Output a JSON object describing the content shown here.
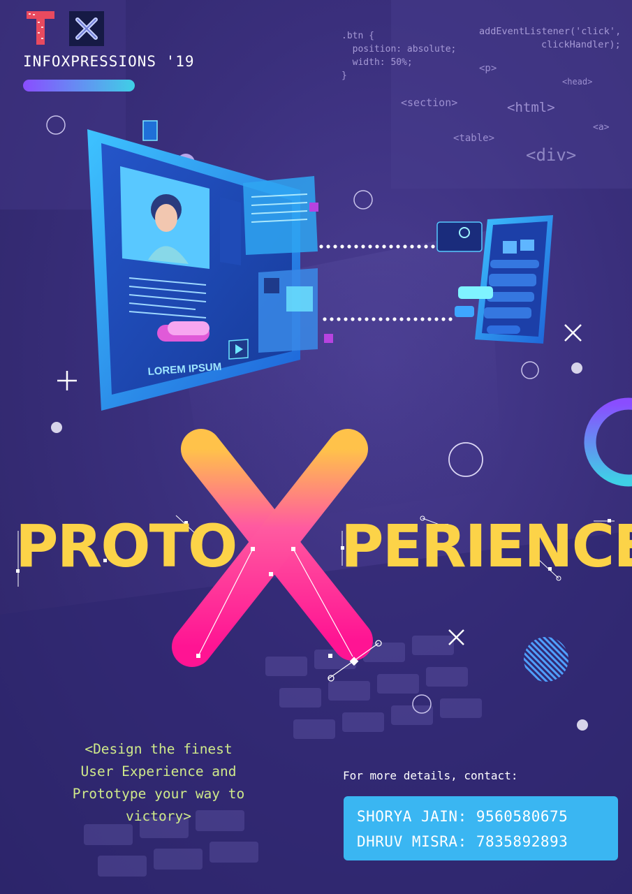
{
  "brand": {
    "logo_t_icon": "T-logo-icon",
    "logo_x_icon": "X-logo-icon",
    "event_name": "INFOXPRESSIONS '19"
  },
  "code_snippets": {
    "css_block": ".btn {\n  position: absolute;\n  width: 50%;\n}",
    "js_line1": "addEventListener('click',",
    "js_line2": "clickHandler);",
    "tags": [
      "<p>",
      "<head>",
      "<section>",
      "<html>",
      "<a>",
      "<table>",
      "<div>"
    ]
  },
  "illustration": {
    "monitor_caption": "LOREM IPSUM"
  },
  "headline": {
    "left_word": "PROTO",
    "center_letter": "X",
    "right_word": "PERIENCE"
  },
  "tagline": {
    "line1": "<Design the finest",
    "line2": "User Experience and",
    "line3": "Prototype your way to",
    "line4": "victory>"
  },
  "contact": {
    "label": "For more details, contact:",
    "person1": "SHORYA JAIN: 9560580675",
    "person2": "DHRUV MISRA: 7835892893"
  },
  "colors": {
    "background": "#3a2f7c",
    "headline_yellow": "#fcd348",
    "x_gradient_top": "#ffb347",
    "x_gradient_bottom": "#ff1f9c",
    "tagline_green": "#cfe98a",
    "contact_box": "#3ab6f2",
    "accent_cyan": "#3fd0e6"
  }
}
